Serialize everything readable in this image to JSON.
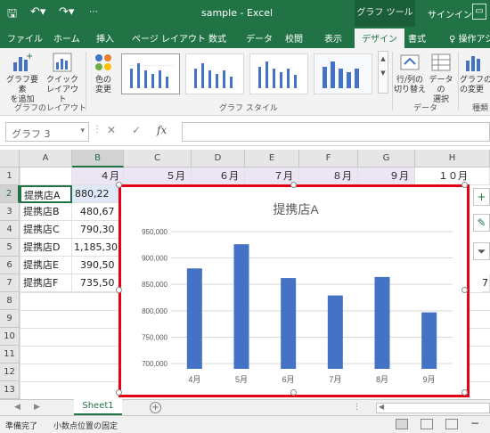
{
  "app": {
    "doc_title": "sample  -  Excel",
    "context_tab": "グラフ ツール",
    "signin": "サインイン"
  },
  "ribbon": {
    "tabs": [
      "ファイル",
      "ホーム",
      "挿入",
      "ページ レイアウト",
      "数式",
      "データ",
      "校閲",
      "表示",
      "デザイン",
      "書式"
    ],
    "active_tab": "デザイン",
    "tell_me": "操作アシ",
    "buttons": {
      "add_element": [
        "グラフ要素",
        "を追加"
      ],
      "quick_layout": [
        "クイック",
        "レイアウト"
      ],
      "change_color": [
        "色の",
        "変更"
      ],
      "switch_rowcol": [
        "行/列の",
        "切り替え"
      ],
      "select_data": [
        "データの",
        "選択"
      ],
      "change_type_partial": [
        "グラフの",
        "の変更"
      ]
    },
    "groups": {
      "layout": "グラフのレイアウト",
      "styles": "グラフ スタイル",
      "data": "データ",
      "type_partial": "種類"
    }
  },
  "formula_bar": {
    "name_box": "グラフ 3",
    "fx_label": "fx",
    "value": ""
  },
  "grid": {
    "columns": [
      "A",
      "B",
      "C",
      "D",
      "E",
      "F",
      "G",
      "H"
    ],
    "rows": [
      "1",
      "2",
      "3",
      "4",
      "5",
      "6",
      "7",
      "8",
      "9",
      "10",
      "11",
      "12",
      "13"
    ],
    "header_row": [
      "４月",
      "５月",
      "６月",
      "７月",
      "８月",
      "９月",
      "１０月"
    ],
    "stores": [
      "提携店A",
      "提携店B",
      "提携店C",
      "提携店D",
      "提携店E",
      "提携店F"
    ],
    "b_values": [
      "880,22",
      "480,67",
      "790,30",
      "1,185,30",
      "390,50",
      "735,50"
    ],
    "h_partial": [
      "",
      "",
      "",
      "",
      "",
      "7"
    ]
  },
  "chart_data": {
    "type": "bar",
    "title": "提携店A",
    "categories": [
      "4月",
      "5月",
      "6月",
      "7月",
      "8月",
      "9月"
    ],
    "values": [
      880220,
      926000,
      862000,
      829000,
      864000,
      797000
    ],
    "yticks": [
      "700,000",
      "750,000",
      "800,000",
      "850,000",
      "900,000",
      "950,000"
    ],
    "ylim": [
      690000,
      960000
    ],
    "bar_color": "#4472c4",
    "grid": true
  },
  "sheets": {
    "tab": "Sheet1",
    "add": "+"
  },
  "status": {
    "ready": "準備完了",
    "mode": "小数点位置の固定"
  }
}
